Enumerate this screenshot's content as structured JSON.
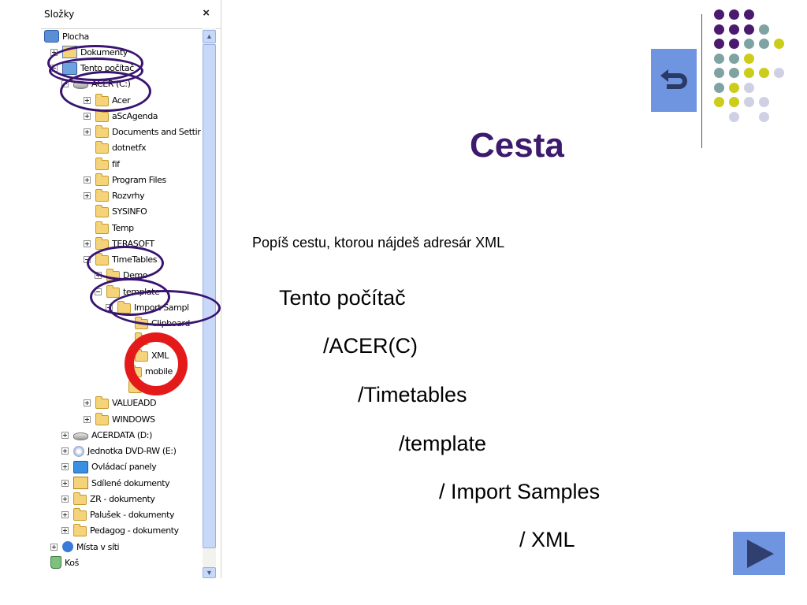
{
  "pane": {
    "title": "Složky",
    "close_symbol": "×",
    "tree": [
      {
        "label": "Plocha",
        "icon": "desktop-icon",
        "expander": "none"
      },
      {
        "label": "Dokumenty",
        "icon": "documents-icon",
        "expander": "plus"
      },
      {
        "label": "Tento počítač",
        "icon": "computer-icon",
        "expander": "minus"
      },
      {
        "label": "ACER (C:)",
        "icon": "drive-icon",
        "expander": "minus"
      },
      {
        "label": "Acer",
        "icon": "folder-icon",
        "expander": "plus"
      },
      {
        "label": "aScAgenda",
        "icon": "folder-icon",
        "expander": "plus"
      },
      {
        "label": "Documents and Settir",
        "icon": "folder-icon",
        "expander": "plus"
      },
      {
        "label": "dotnetfx",
        "icon": "folder-icon",
        "expander": "none"
      },
      {
        "label": "fif",
        "icon": "folder-icon",
        "expander": "none"
      },
      {
        "label": "Program Files",
        "icon": "folder-icon",
        "expander": "plus"
      },
      {
        "label": "Rozvrhy",
        "icon": "folder-icon",
        "expander": "plus"
      },
      {
        "label": "SYSINFO",
        "icon": "folder-icon",
        "expander": "none"
      },
      {
        "label": "Temp",
        "icon": "folder-icon",
        "expander": "none"
      },
      {
        "label": "TERASOFT",
        "icon": "folder-icon",
        "expander": "plus"
      },
      {
        "label": "TimeTables",
        "icon": "folder-icon",
        "expander": "minus"
      },
      {
        "label": "Demo",
        "icon": "folder-icon",
        "expander": "plus"
      },
      {
        "label": "template",
        "icon": "folder-icon",
        "expander": "minus"
      },
      {
        "label": "Import Sampl",
        "icon": "folder-icon",
        "expander": "minus"
      },
      {
        "label": "Clipboard",
        "icon": "folder-icon",
        "expander": "none"
      },
      {
        "label": "Exc",
        "icon": "folder-icon",
        "expander": "none"
      },
      {
        "label": "XML",
        "icon": "folder-icon",
        "expander": "none"
      },
      {
        "label": "mobile",
        "icon": "folder-icon",
        "expander": "none"
      },
      {
        "label": "",
        "icon": "folder-icon",
        "expander": "none"
      },
      {
        "label": "VALUEADD",
        "icon": "folder-icon",
        "expander": "plus"
      },
      {
        "label": "WINDOWS",
        "icon": "folder-icon",
        "expander": "plus"
      },
      {
        "label": "ACERDATA (D:)",
        "icon": "drive-icon",
        "expander": "plus"
      },
      {
        "label": "Jednotka DVD-RW (E:)",
        "icon": "dvd-icon",
        "expander": "plus"
      },
      {
        "label": "Ovládací panely",
        "icon": "control-panel-icon",
        "expander": "plus"
      },
      {
        "label": "Sdílené dokumenty",
        "icon": "shared-folder-icon",
        "expander": "plus"
      },
      {
        "label": "ZR - dokumenty",
        "icon": "folder-icon",
        "expander": "plus"
      },
      {
        "label": "Palušek - dokumenty",
        "icon": "folder-icon",
        "expander": "plus"
      },
      {
        "label": "Pedagog - dokumenty",
        "icon": "folder-icon",
        "expander": "plus"
      },
      {
        "label": "Místa v síti",
        "icon": "network-icon",
        "expander": "plus"
      },
      {
        "label": "Koš",
        "icon": "recycle-bin-icon",
        "expander": "none"
      }
    ]
  },
  "slide": {
    "title": "Cesta",
    "instruction": "Popíš cestu, ktorou nájdeš adresár XML",
    "path": [
      "Tento počítač",
      "/ACER(C)",
      "/Timetables",
      "/template",
      "/ Import Samples",
      "/ XML"
    ]
  },
  "colors": {
    "title": "#3d1a6e",
    "button": "#6f94e0",
    "annotation_ellipse": "#3a1470",
    "annotation_ring": "#e41a1a",
    "dot_purple": "#4b1a6e",
    "dot_teal": "#7fa3a3",
    "dot_yellow": "#cccc1a",
    "dot_lavender": "#d0d0e4"
  }
}
